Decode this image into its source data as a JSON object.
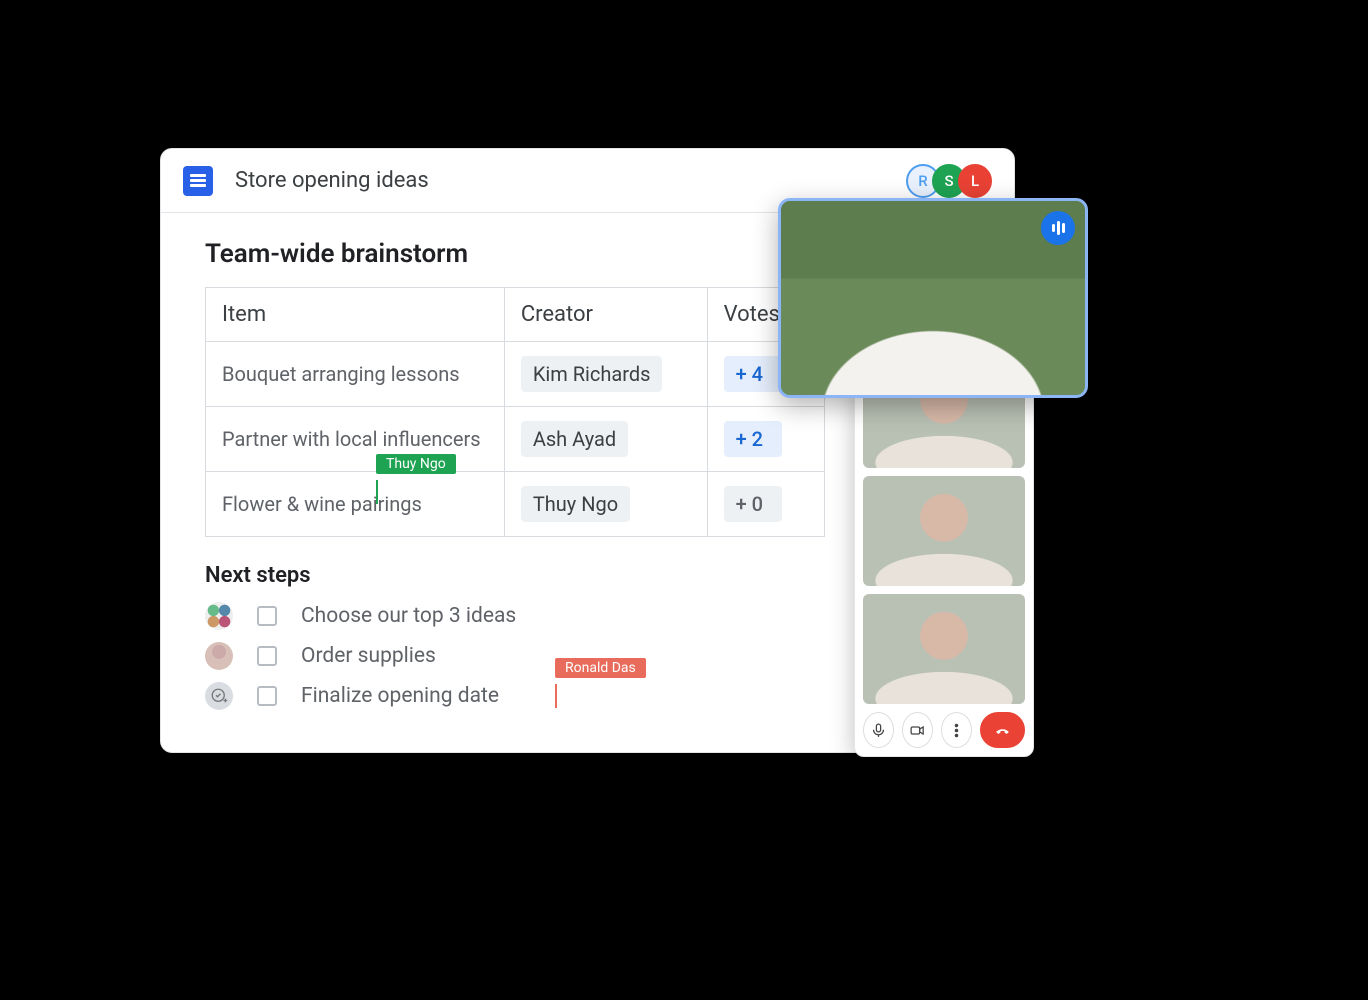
{
  "doc": {
    "title": "Store opening ideas",
    "collaborators": [
      {
        "initial": "R",
        "color": "blue"
      },
      {
        "initial": "S",
        "color": "green"
      },
      {
        "initial": "L",
        "color": "red"
      }
    ]
  },
  "section": {
    "heading": "Team-wide brainstorm",
    "columns": {
      "c1": "Item",
      "c2": "Creator",
      "c3": "Votes"
    },
    "rows": [
      {
        "item": "Bouquet arranging lessons",
        "creator": "Kim Richards",
        "votes_label": "+ 4",
        "votes_active": true
      },
      {
        "item": "Partner with local influencers",
        "creator": "Ash Ayad",
        "votes_label": "+ 2",
        "votes_active": true
      },
      {
        "item": "Flower & wine pairings",
        "creator": "Thuy Ngo",
        "votes_label": "+ 0",
        "votes_active": false
      }
    ],
    "cursors": {
      "green_label": "Thuy Ngo",
      "red_label": "Ronald Das"
    }
  },
  "next_steps": {
    "heading": "Next steps",
    "items": [
      {
        "text": "Choose our top 3 ideas",
        "assignee_kind": "multi"
      },
      {
        "text": "Order supplies",
        "assignee_kind": "person"
      },
      {
        "text": "Finalize opening date",
        "assignee_kind": "add"
      }
    ]
  },
  "call": {
    "speaker_audio_active": true,
    "controls": {
      "mic": "mic",
      "cam": "cam",
      "more": "more",
      "hangup": "hangup"
    }
  }
}
